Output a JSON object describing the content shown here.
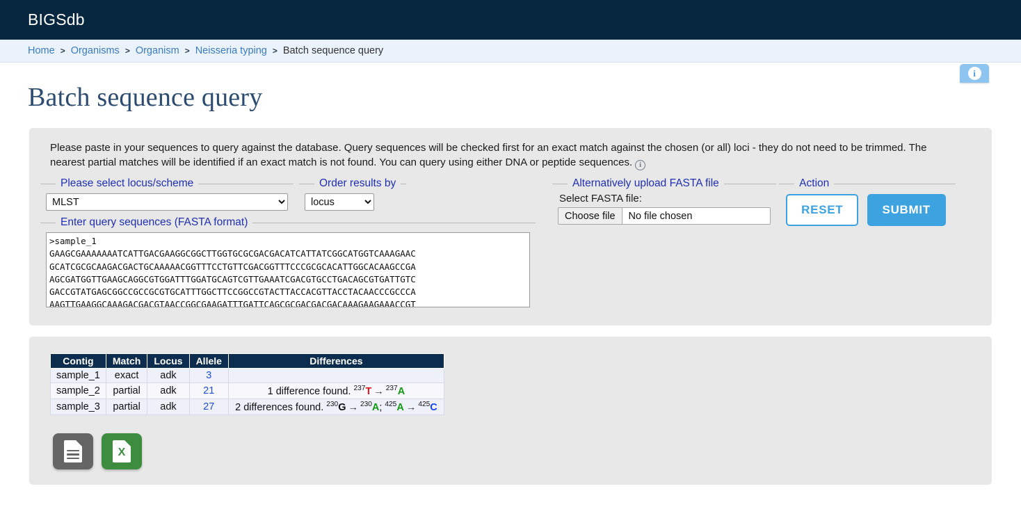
{
  "header": {
    "app_title": "BIGSdb"
  },
  "breadcrumb": {
    "items": [
      "Home",
      "Organisms",
      "Organism",
      "Neisseria typing",
      "Batch sequence query"
    ],
    "separator": ">"
  },
  "info_tab": {
    "icon": "info-icon",
    "glyph": "i"
  },
  "page": {
    "title": "Batch sequence query"
  },
  "intro": {
    "text": "Please paste in your sequences to query against the database. Query sequences will be checked first for an exact match against the chosen (or all) loci - they do not need to be trimmed. The nearest partial matches will be identified if an exact match is not found. You can query using either DNA or peptide sequences.",
    "info_glyph": "i"
  },
  "form": {
    "locus_fieldset_legend": "Please select locus/scheme",
    "locus_selected": "MLST",
    "locus_options": [
      "MLST"
    ],
    "order_fieldset_legend": "Order results by",
    "order_selected": "locus",
    "order_options": [
      "locus"
    ],
    "sequence_fieldset_legend": "Enter query sequences (FASTA format)",
    "sequence_value": ">sample_1\nGAAGCGAAAAAAATCATTGACGAAGGCGGCTTGGTGCGCGACGACATCATTATCGGCATGGTCAAAGAAC\nGCATCGCGCAAGACGACTGCAAAAACGGTTTCCTGTTCGACGGTTTCCCGCGCACATTGGCACAAGCCGA\nAGCGATGGTTGAAGCAGGCGTGGATTTGGATGCAGTCGTTGAAATCGACGTGCCTGACAGCGTGATTGTC\nGACCGTATGAGCGGCCGCCGCGTGCATTTGGCTTCCGGCCGTACTTACCACGTTACCTACAACCCGCCCA\nAAGTTGAAGGCAAAGACGACGTAACCGGCGAAGATTTGATTCAGCGCGACGACGACAAAGAAGAAACCGT",
    "upload_fieldset_legend": "Alternatively upload FASTA file",
    "file_label": "Select FASTA file:",
    "file_button": "Choose file",
    "file_status": "No file chosen",
    "action_fieldset_legend": "Action",
    "reset_label": "RESET",
    "submit_label": "SUBMIT"
  },
  "results": {
    "columns": [
      "Contig",
      "Match",
      "Locus",
      "Allele",
      "Differences"
    ],
    "rows": [
      {
        "contig": "sample_1",
        "match": "exact",
        "locus": "adk",
        "allele": "3",
        "diff_prefix": "",
        "diffs": []
      },
      {
        "contig": "sample_2",
        "match": "partial",
        "locus": "adk",
        "allele": "21",
        "diff_prefix": "1 difference found.",
        "diffs": [
          {
            "pos_from": "237",
            "from": "T",
            "from_color": "red",
            "pos_to": "237",
            "to": "A",
            "to_color": "green",
            "tail": ""
          }
        ]
      },
      {
        "contig": "sample_3",
        "match": "partial",
        "locus": "adk",
        "allele": "27",
        "diff_prefix": "2 differences found.",
        "diffs": [
          {
            "pos_from": "230",
            "from": "G",
            "from_color": "black",
            "pos_to": "230",
            "to": "A",
            "to_color": "green",
            "tail": ";"
          },
          {
            "pos_from": "425",
            "from": "A",
            "from_color": "green",
            "pos_to": "425",
            "to": "C",
            "to_color": "blue",
            "tail": ""
          }
        ]
      }
    ]
  },
  "export": {
    "text_icon": "text-file-icon",
    "excel_icon": "excel-file-icon",
    "excel_glyph": "X"
  },
  "colors": {
    "header_bg": "#07263f",
    "breadcrumb_bg": "#eaf2fb",
    "link": "#3a7bbf",
    "title": "#2b4b6f",
    "panel_bg": "#e8e8e8",
    "accent": "#3da2e0",
    "legend": "#2030b0",
    "table_header_bg": "#0d2d4e",
    "nt_A": "#119911",
    "nt_T": "#e01b1b",
    "nt_C": "#1144ee",
    "nt_G": "#111111",
    "excel_green": "#3d8c40",
    "text_gray": "#656565"
  }
}
